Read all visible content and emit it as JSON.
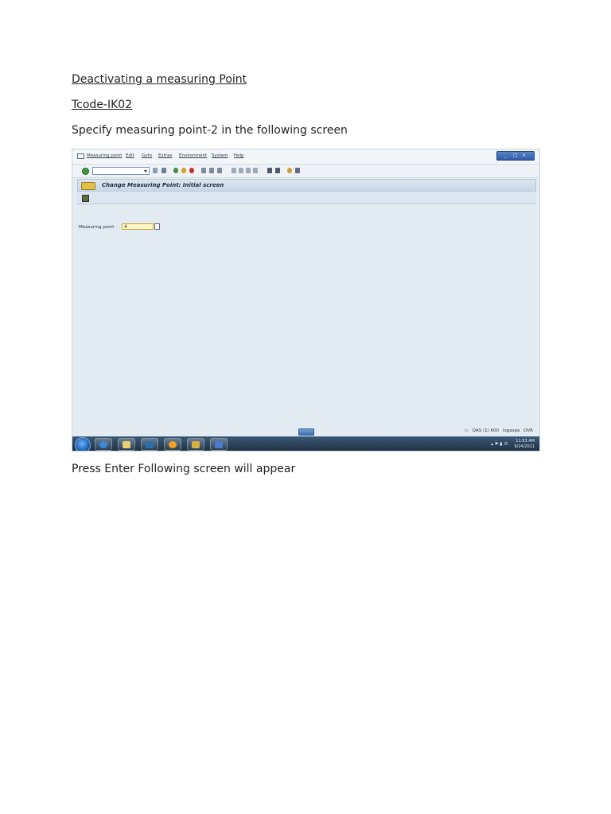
{
  "document": {
    "heading": "Deactivating a measuring Point",
    "tcode": "Tcode-IK02",
    "instruction": "Specify measuring point-2 in the following screen",
    "after_text": "Press Enter Following screen will appear"
  },
  "screenshot": {
    "menu": [
      "Measuring point",
      "Edit",
      "Goto",
      "Extras",
      "Environment",
      "System",
      "Help"
    ],
    "window_controls": [
      "_",
      "□",
      "×"
    ],
    "title": "Change Measuring Point: Initial screen",
    "field_label": "Measuring point",
    "field_value": "4",
    "status": {
      "system": "QAS (1) 600",
      "user": "tsgaspa",
      "mode": "OVR"
    },
    "clock": {
      "time": "11:53 AM",
      "date": "9/24/2011"
    }
  }
}
